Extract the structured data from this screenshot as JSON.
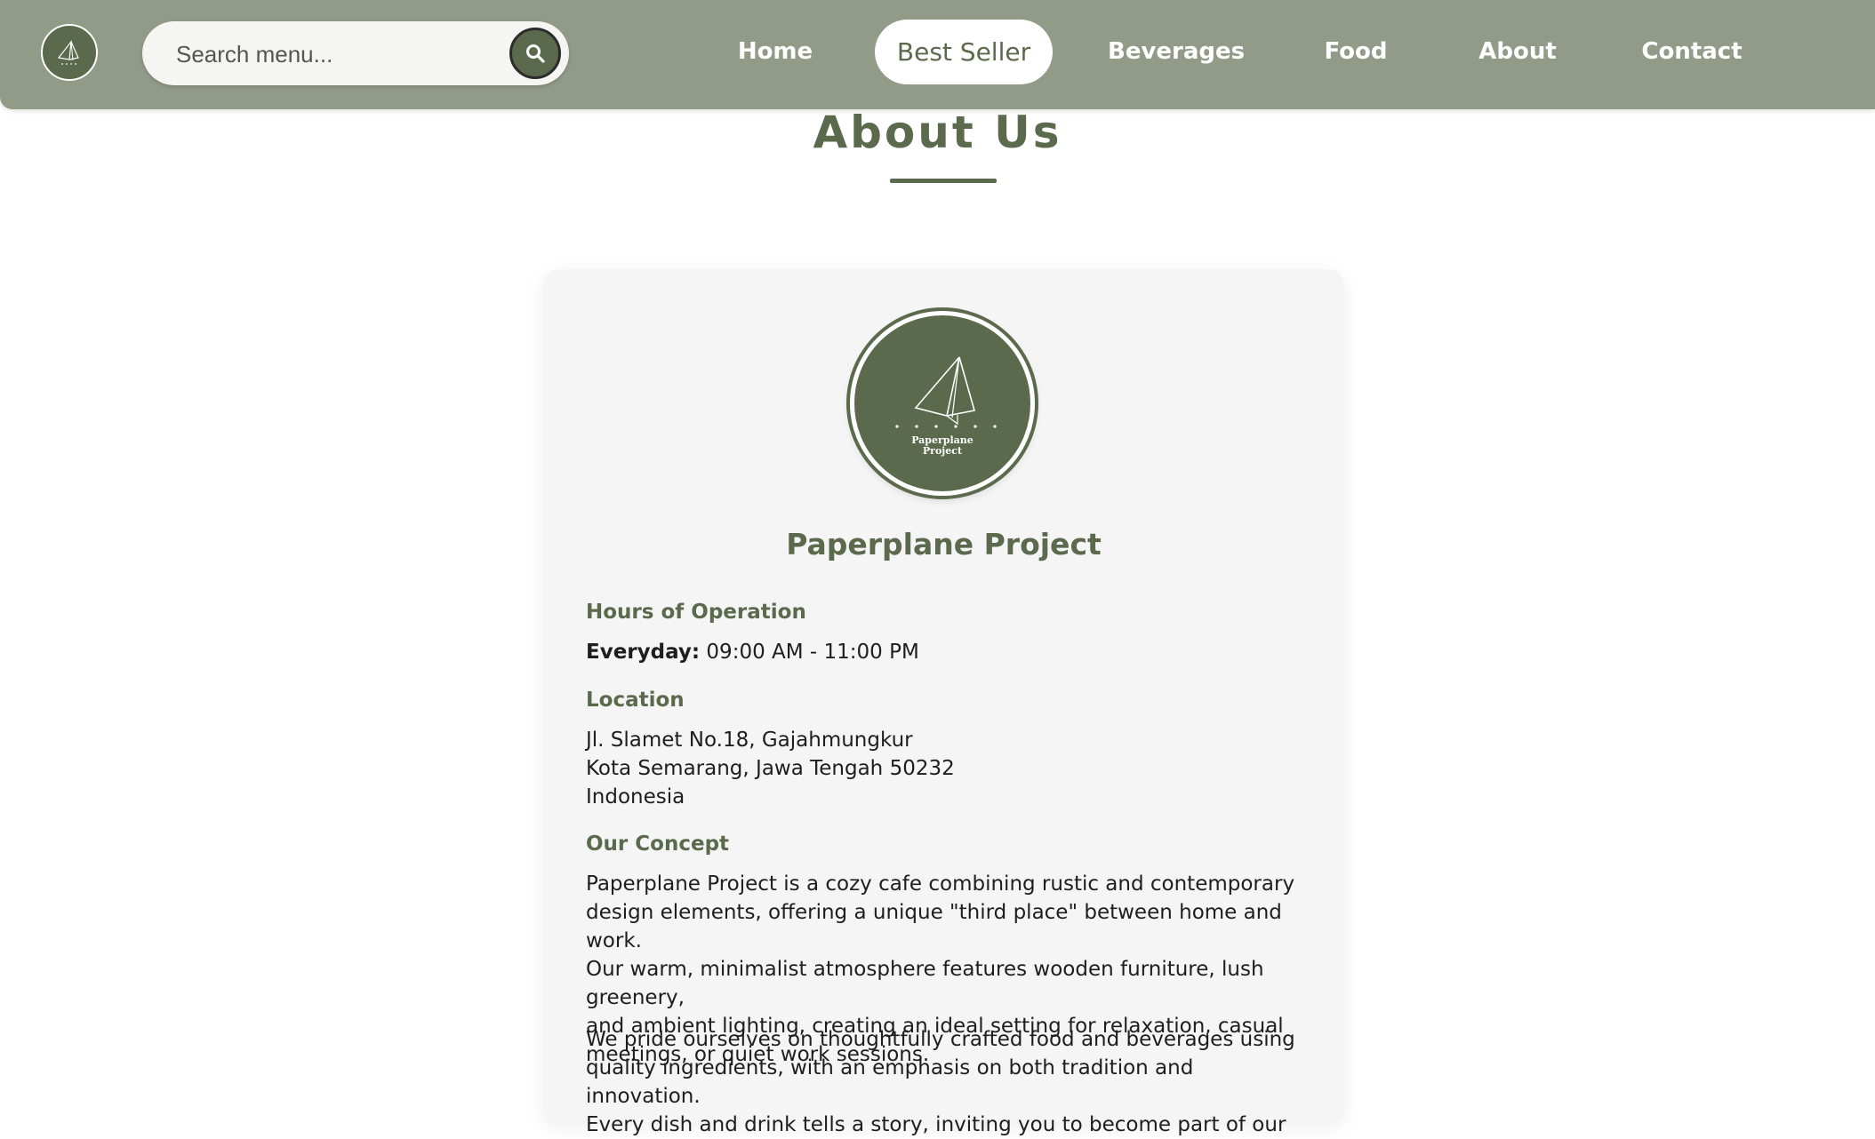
{
  "nav": {
    "logo_icon": "paperplane-logo-icon",
    "search_placeholder": "Search menu...",
    "search_icon": "search-icon",
    "links": [
      {
        "label": "Home",
        "active": false
      },
      {
        "label": "Best Seller",
        "active": true
      },
      {
        "label": "Beverages",
        "active": false
      },
      {
        "label": "Food",
        "active": false
      },
      {
        "label": "About",
        "active": false
      },
      {
        "label": "Contact",
        "active": false
      }
    ]
  },
  "page": {
    "title": "About Us"
  },
  "card": {
    "logo_text_line1": "Paperplane",
    "logo_text_line2": "Project",
    "name": "Paperplane Project",
    "hours_heading": "Hours of Operation",
    "hours_label": "Everyday:",
    "hours_value": "09:00 AM - 11:00 PM",
    "location_heading": "Location",
    "location_lines": [
      "Jl. Slamet No.18, Gajahmungkur",
      "Kota Semarang, Jawa Tengah 50232",
      "Indonesia"
    ],
    "concept_heading": "Our Concept",
    "concept_p1_lines": [
      "Paperplane Project is a cozy cafe combining rustic and contemporary",
      "design elements, offering a unique \"third place\" between home and work.",
      "Our warm, minimalist atmosphere features wooden furniture, lush greenery,",
      "and ambient lighting, creating an ideal setting for relaxation, casual",
      "meetings, or quiet work sessions."
    ],
    "concept_p2_lines": [
      "We pride ourselves on thoughtfully crafted food and beverages using",
      "quality ingredients, with an emphasis on both tradition and innovation.",
      "Every dish and drink tells a story, inviting you to become part of our"
    ]
  },
  "colors": {
    "navbar_bg": "#929a88",
    "accent_green": "#5b6a4c",
    "card_bg": "#f5f5f5"
  }
}
